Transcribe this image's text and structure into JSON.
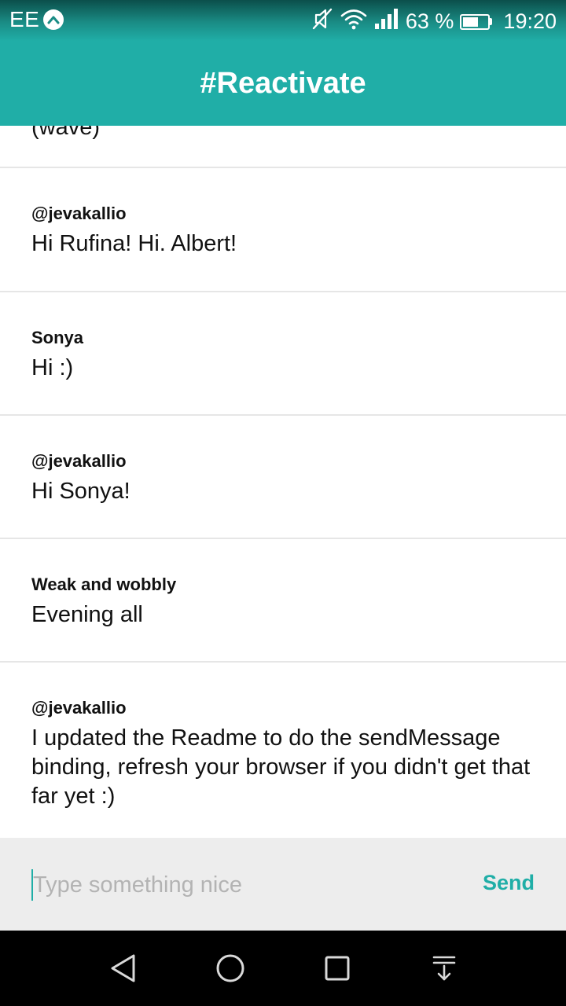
{
  "status_bar": {
    "carrier": "EE",
    "battery_percent": "63 %",
    "battery_level": 0.63,
    "time": "19:20",
    "icons": [
      "carrier-badge-icon",
      "mute-icon",
      "wifi-icon",
      "signal-icon",
      "battery-icon"
    ]
  },
  "app_bar": {
    "title": "#Reactivate"
  },
  "messages": [
    {
      "author": "",
      "text": "(wave)"
    },
    {
      "author": "@jevakallio",
      "text": "Hi Rufina! Hi. Albert!"
    },
    {
      "author": "Sonya",
      "text": "Hi :)"
    },
    {
      "author": "@jevakallio",
      "text": "Hi Sonya!"
    },
    {
      "author": "Weak and wobbly",
      "text": "Evening all"
    },
    {
      "author": "@jevakallio",
      "text": "I updated the Readme to do the sendMessage binding, refresh your browser if you didn't get that far yet :)"
    }
  ],
  "composer": {
    "placeholder": "Type something nice",
    "value": "",
    "send_label": "Send"
  },
  "nav_bar": {
    "icons": [
      "back-icon",
      "home-icon",
      "recents-icon",
      "notification-shade-icon"
    ]
  },
  "colors": {
    "accent": "#20aea7",
    "composer_bg": "#ededed",
    "divider": "#e6e6e6",
    "nav_bg": "#000000"
  }
}
